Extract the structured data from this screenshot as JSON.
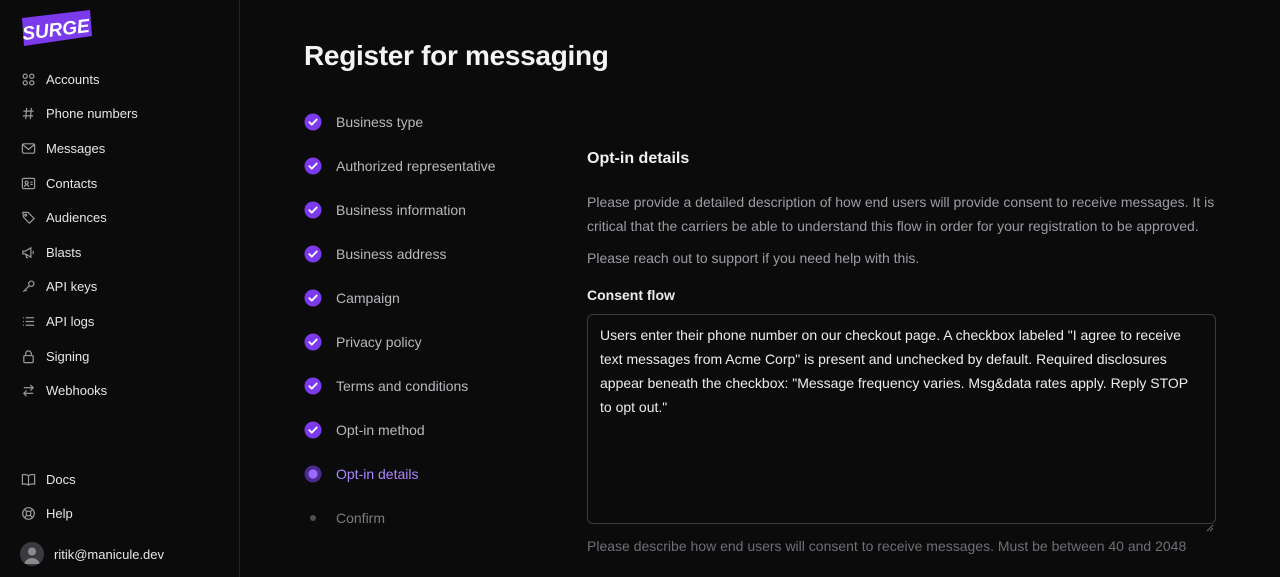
{
  "brand": {
    "logo_text": "SURGE",
    "accent": "#7c3aed"
  },
  "sidebar": {
    "items": [
      {
        "label": "Accounts",
        "icon": "accounts-icon"
      },
      {
        "label": "Phone numbers",
        "icon": "hash-icon"
      },
      {
        "label": "Messages",
        "icon": "mail-icon"
      },
      {
        "label": "Contacts",
        "icon": "contact-card-icon"
      },
      {
        "label": "Audiences",
        "icon": "tag-icon"
      },
      {
        "label": "Blasts",
        "icon": "megaphone-icon"
      },
      {
        "label": "API keys",
        "icon": "key-icon"
      },
      {
        "label": "API logs",
        "icon": "list-icon"
      },
      {
        "label": "Signing",
        "icon": "lock-icon"
      },
      {
        "label": "Webhooks",
        "icon": "arrows-icon"
      }
    ],
    "bottom_items": [
      {
        "label": "Docs",
        "icon": "book-icon"
      },
      {
        "label": "Help",
        "icon": "help-icon"
      }
    ],
    "user": {
      "email": "ritik@manicule.dev"
    }
  },
  "page": {
    "title": "Register for messaging"
  },
  "steps": [
    {
      "label": "Business type",
      "status": "done"
    },
    {
      "label": "Authorized representative",
      "status": "done"
    },
    {
      "label": "Business information",
      "status": "done"
    },
    {
      "label": "Business address",
      "status": "done"
    },
    {
      "label": "Campaign",
      "status": "done"
    },
    {
      "label": "Privacy policy",
      "status": "done"
    },
    {
      "label": "Terms and conditions",
      "status": "done"
    },
    {
      "label": "Opt-in method",
      "status": "done"
    },
    {
      "label": "Opt-in details",
      "status": "current"
    },
    {
      "label": "Confirm",
      "status": "pending"
    }
  ],
  "optin": {
    "heading": "Opt-in details",
    "description": "Please provide a detailed description of how end users will provide consent to receive messages. It is critical that the carriers be able to understand this flow in order for your registration to be approved.",
    "support_note": "Please reach out to support if you need help with this.",
    "consent_label": "Consent flow",
    "consent_value": "Users enter their phone number on our checkout page. A checkbox labeled \"I agree to receive text messages from Acme Corp\" is present and unchecked by default. Required disclosures appear beneath the checkbox: \"Message frequency varies. Msg&data rates apply. Reply STOP to opt out.\"",
    "helper": "Please describe how end users will consent to receive messages. Must be between 40 and 2048"
  }
}
